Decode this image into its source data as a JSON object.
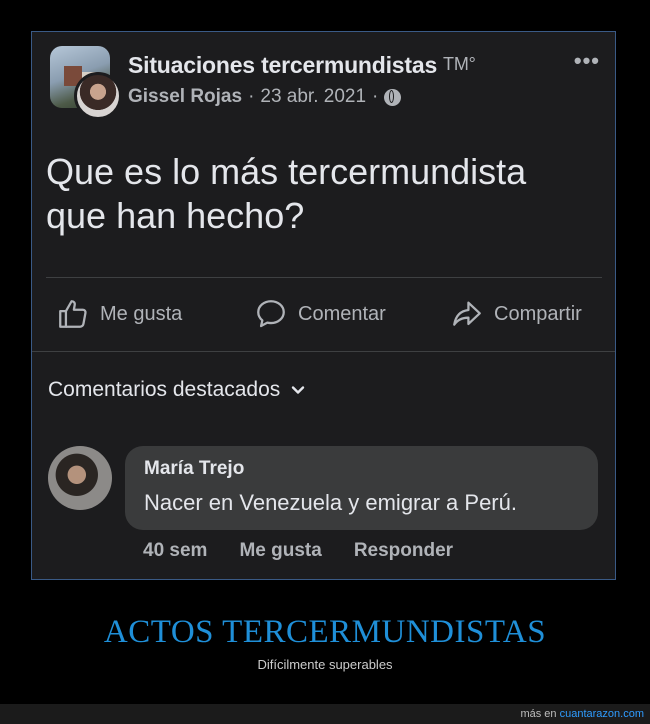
{
  "post": {
    "group_name": "Situaciones tercermundistas",
    "group_mark": "TM°",
    "author": "Gissel Rojas",
    "separator": "·",
    "date": "23 abr. 2021",
    "more_icon": "more-horizontal-icon",
    "privacy_icon": "globe-icon",
    "text": "Que es lo más tercermundista que han hecho?"
  },
  "actions": {
    "like": "Me gusta",
    "comment": "Comentar",
    "share": "Compartir"
  },
  "comments": {
    "filter_label": "Comentarios destacados",
    "items": [
      {
        "author": "María Trejo",
        "text": "Nacer en Venezuela y emigrar a Perú.",
        "time": "40 sem",
        "like": "Me gusta",
        "reply": "Responder"
      }
    ]
  },
  "caption": {
    "title": "ACTOS TERCERMUNDISTAS",
    "subtitle": "Difícilmente superables"
  },
  "footer": {
    "prefix": "más en",
    "site": "cuantarazon.com"
  },
  "colors": {
    "page_bg": "#000000",
    "card_bg": "#1c1c1e",
    "text_primary": "#e4e6eb",
    "text_secondary": "#b0b3b8",
    "bubble_bg": "#3a3b3c",
    "caption": "#1f8fd8",
    "link": "#2f9cff"
  }
}
